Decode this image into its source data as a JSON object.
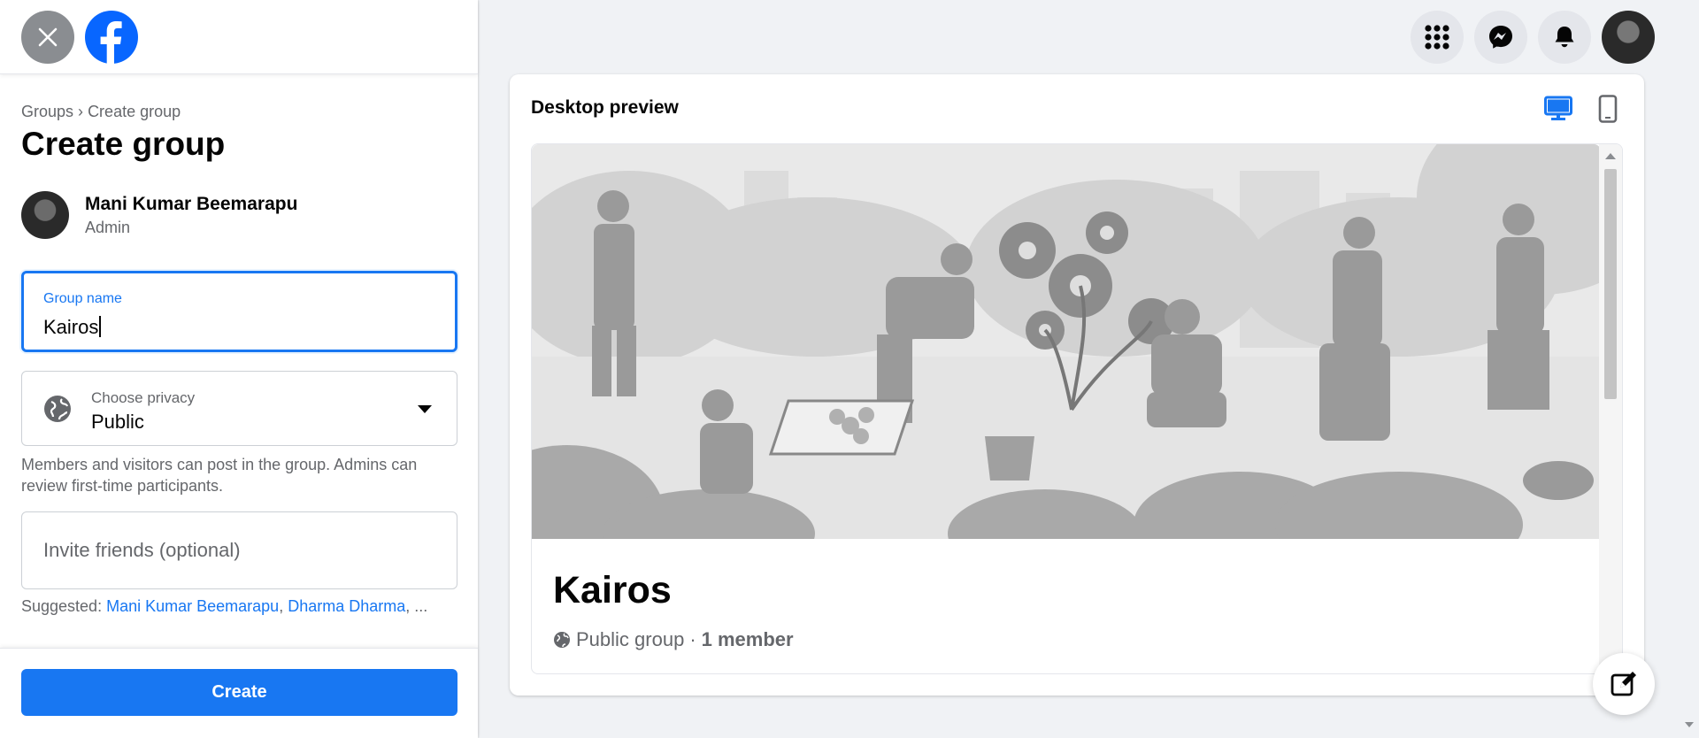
{
  "breadcrumb": {
    "groups": "Groups",
    "separator": "›",
    "current": "Create group"
  },
  "page_title": "Create group",
  "admin": {
    "name": "Mani Kumar Beemarapu",
    "role": "Admin"
  },
  "group_name_field": {
    "label": "Group name",
    "value": "Kairos"
  },
  "privacy": {
    "label": "Choose privacy",
    "value": "Public",
    "description": "Members and visitors can post in the group. Admins can review first-time participants."
  },
  "invite": {
    "placeholder": "Invite friends (optional)"
  },
  "suggested": {
    "label": "Suggested:",
    "people": [
      "Mani Kumar Beemarapu",
      "Dharma Dharma"
    ],
    "more": "..."
  },
  "create_button": "Create",
  "preview": {
    "title": "Desktop preview",
    "group_name": "Kairos",
    "privacy_text": "Public group",
    "separator": "·",
    "member_count": "1 member"
  },
  "colors": {
    "accent": "#1877f2",
    "brand": "#0866ff",
    "background": "#f0f2f5"
  },
  "icons": [
    "close-icon",
    "facebook-logo-icon",
    "globe-icon",
    "apps-grid-icon",
    "messenger-icon",
    "bell-icon",
    "desktop-icon",
    "mobile-icon",
    "edit-icon"
  ]
}
